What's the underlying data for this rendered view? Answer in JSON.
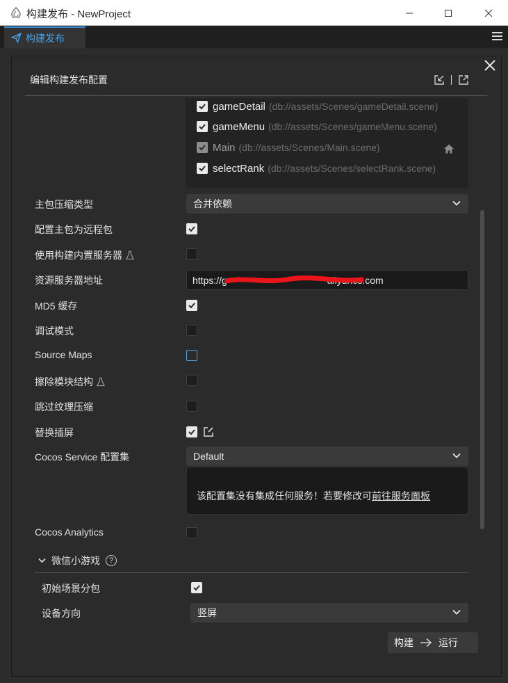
{
  "window": {
    "title": "构建发布 - NewProject",
    "minimize_glyph": "—",
    "maximize_glyph": "☐",
    "close_glyph": "✕"
  },
  "tab": {
    "label": "构建发布",
    "icon": "send-icon"
  },
  "dialog": {
    "title": "编辑构建发布配置",
    "header_icons": [
      "import-icon",
      "export-icon"
    ]
  },
  "scenes": [
    {
      "name": "gameDetail",
      "path": "(db://assets/Scenes/gameDetail.scene)",
      "checked": true
    },
    {
      "name": "gameMenu",
      "path": "(db://assets/Scenes/gameMenu.scene)",
      "checked": true
    },
    {
      "name": "Main",
      "path": "(db://assets/Scenes/Main.scene)",
      "checked": true,
      "start_scene": true
    },
    {
      "name": "selectRank",
      "path": "(db://assets/Scenes/selectRank.scene)",
      "checked": true
    }
  ],
  "settings": {
    "compression_type": {
      "label": "主包压缩类型",
      "value": "合并依赖"
    },
    "remote_main_bundle": {
      "label": "配置主包为远程包",
      "checked": true
    },
    "builtin_server": {
      "label": "使用构建内置服务器",
      "checked": false,
      "experimental": true
    },
    "resource_server": {
      "label": "资源服务器地址",
      "value": "https://g                                     aliyuncs.com",
      "visible_prefix": "https://",
      "visible_suffix": ".aliyuncs.com"
    },
    "md5_cache": {
      "label": "MD5 缓存",
      "checked": true
    },
    "debug_mode": {
      "label": "调试模式",
      "checked": false
    },
    "source_maps": {
      "label": "Source Maps",
      "checked": false
    },
    "erase_module": {
      "label": "擦除模块结构",
      "checked": false,
      "experimental": true
    },
    "skip_texture": {
      "label": "跳过纹理压缩",
      "checked": false
    },
    "replace_splash": {
      "label": "替换插屏",
      "checked": true
    },
    "cocos_service": {
      "label": "Cocos Service 配置集",
      "value": "Default"
    },
    "service_message": {
      "text": "该配置集没有集成任何服务！若要修改可",
      "link": "前往服务面板"
    },
    "cocos_analytics": {
      "label": "Cocos Analytics",
      "checked": false
    }
  },
  "wechat": {
    "section_title": "微信小游戏",
    "help_glyph": "?",
    "initial_subpackage": {
      "label": "初始场景分包",
      "checked": true
    },
    "orientation": {
      "label": "设备方向",
      "value": "竖屏"
    }
  },
  "actions": {
    "build_label": "构建",
    "run_label": "运行"
  },
  "colors": {
    "accent": "#4aa3ea",
    "panel_bg": "#2b2b2b",
    "checkbox_on": "#e9e9e9",
    "redaction": "#e8161b"
  }
}
